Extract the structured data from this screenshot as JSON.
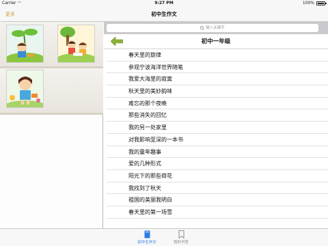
{
  "status_bar": {
    "carrier": "Carrier",
    "time": "9:27 PM",
    "battery": "100%"
  },
  "nav": {
    "more_label": "更多",
    "title": "初中生作文"
  },
  "search": {
    "placeholder": "输入关键字"
  },
  "grade": {
    "title": "初中一年级"
  },
  "essays": [
    "春天里的旋律",
    "参观宁波海洋世界随笔",
    "我爱大海里的寂寞",
    "秋天里的美妙韵味",
    "难忘的那个夜晚",
    "那些消失的回忆",
    "我的另一处家里",
    "对我影响至深的一本书",
    "我的童年趣事",
    "爱的几种形式",
    "阳光下的那些荷花",
    "我找到了秋天",
    "祖国的美丽我明白",
    "春天里的第一场雪"
  ],
  "tabs": [
    {
      "label": "初中生作文",
      "active": true
    },
    {
      "label": "我的书签",
      "active": false
    }
  ],
  "colors": {
    "accent_gold": "#c9a23a",
    "accent_blue": "#2a7de1",
    "arrow_green": "#8fb23a"
  }
}
